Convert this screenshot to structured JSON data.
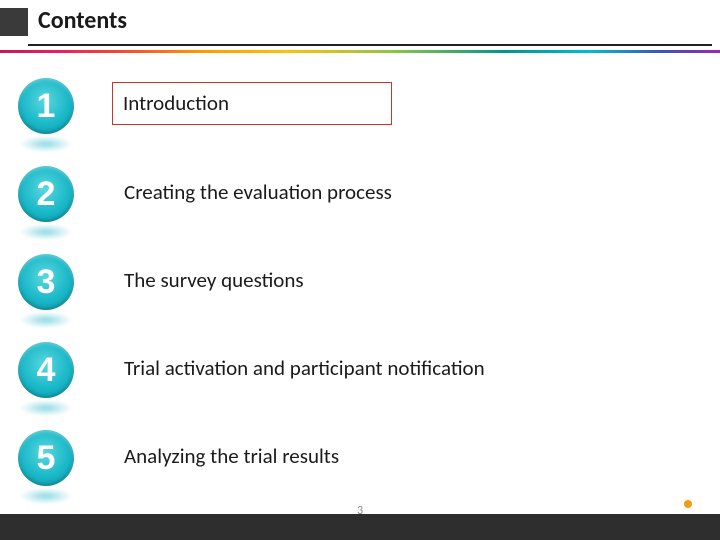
{
  "header": {
    "title": "Contents"
  },
  "items": [
    {
      "num": "1",
      "label": "Introduction",
      "highlighted": true
    },
    {
      "num": "2",
      "label": "Creating the evaluation process",
      "highlighted": false
    },
    {
      "num": "3",
      "label": "The survey questions",
      "highlighted": false
    },
    {
      "num": "4",
      "label": "Trial activation and participant notification",
      "highlighted": false
    },
    {
      "num": "5",
      "label": "Analyzing the trial results",
      "highlighted": false
    }
  ],
  "footer": {
    "page_number": "3"
  },
  "colors": {
    "badge": "#19b7c7",
    "highlight_border": "#c0392b",
    "footer_bg": "#2e2e2e"
  }
}
